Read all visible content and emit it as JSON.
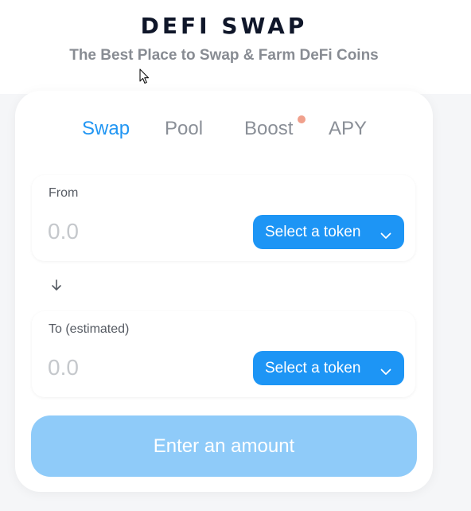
{
  "header": {
    "title": "DEFI SWAP",
    "subtitle": "The Best Place to Swap & Farm DeFi Coins"
  },
  "tabs": [
    {
      "label": "Swap",
      "active": true
    },
    {
      "label": "Pool",
      "active": false
    },
    {
      "label": "Boost",
      "active": false,
      "has_notification_dot": true
    },
    {
      "label": "APY",
      "active": false
    }
  ],
  "from_panel": {
    "label": "From",
    "amount_placeholder": "0.0",
    "token_button_label": "Select a token",
    "token_button_icon": "chevron-down-icon"
  },
  "swap_direction_icon": "arrow-down-icon",
  "to_panel": {
    "label": "To (estimated)",
    "amount_placeholder": "0.0",
    "token_button_label": "Select a token",
    "token_button_icon": "chevron-down-icon"
  },
  "action_button": {
    "label": "Enter an amount",
    "disabled": true
  },
  "colors": {
    "accent": "#2196f3",
    "button_primary": "#1d95f5",
    "button_disabled": "#8fcbf9",
    "notification_dot": "#f0a08c",
    "title": "#0f1629",
    "muted_text": "#888c93"
  }
}
